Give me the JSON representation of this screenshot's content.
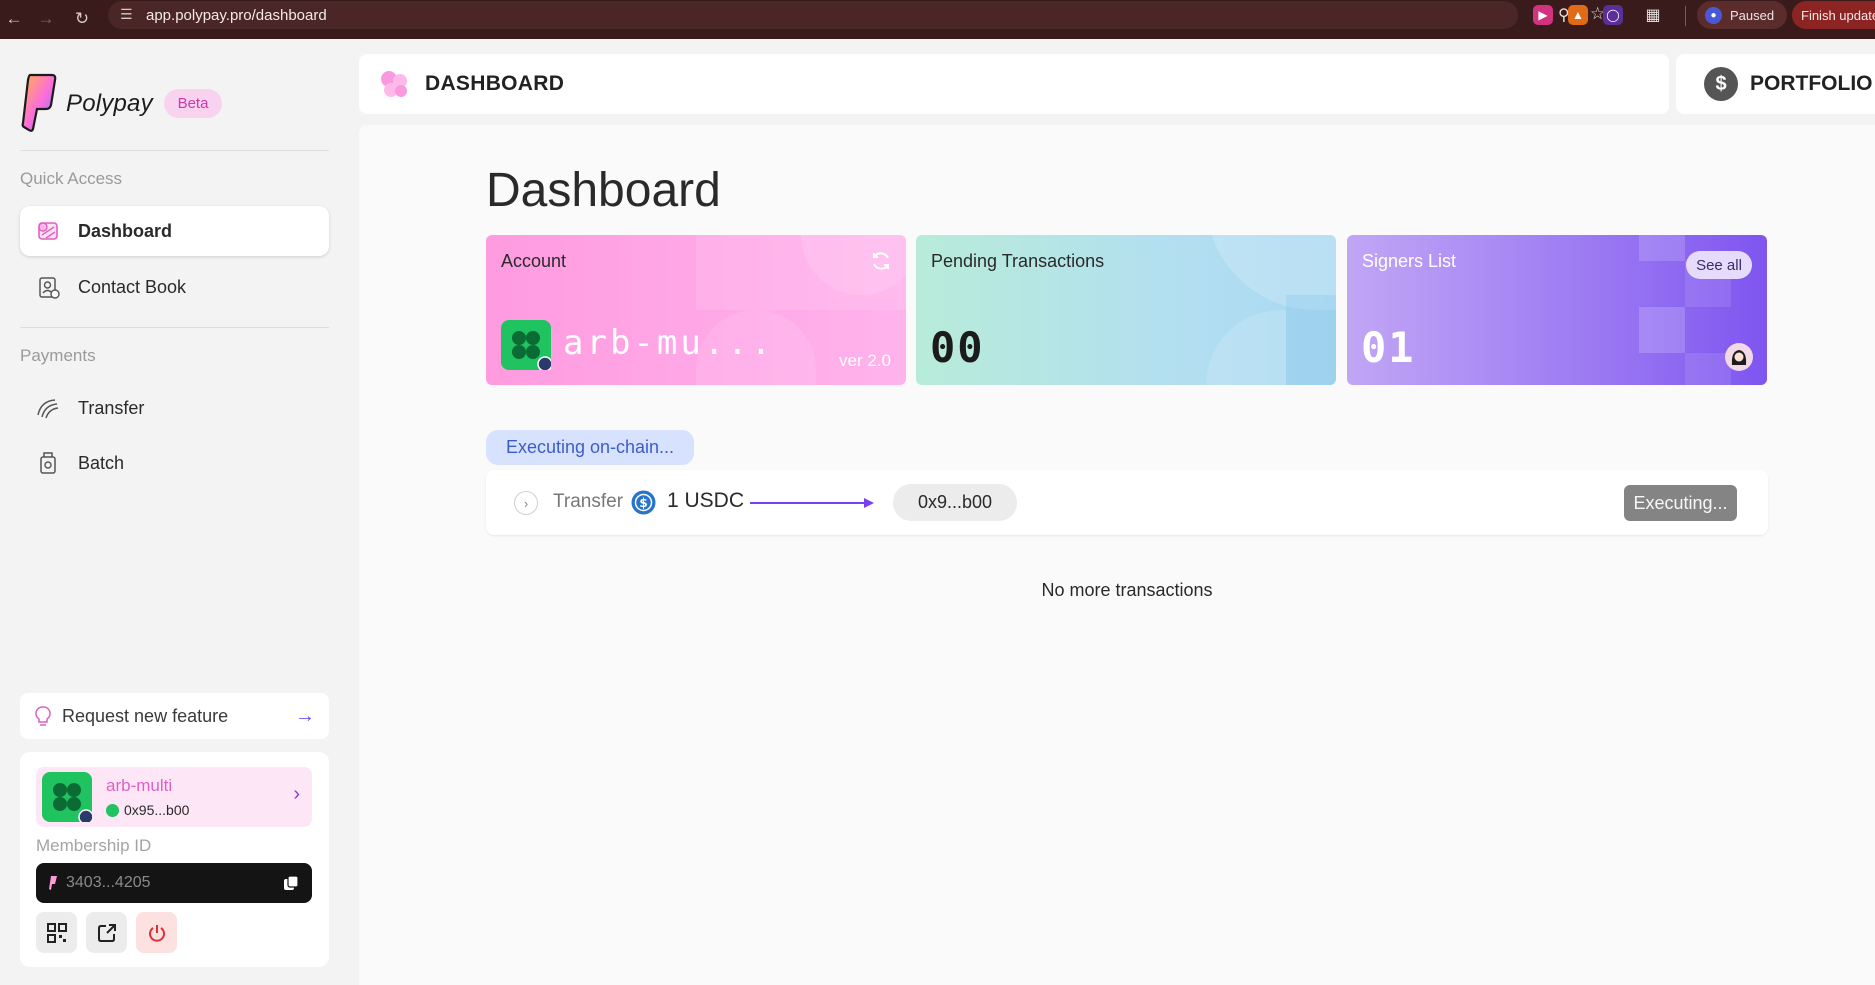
{
  "browser": {
    "url": "app.polypay.pro/dashboard",
    "profile_status": "Paused",
    "update_label": "Finish update"
  },
  "sidebar": {
    "brand": "Polypay",
    "badge": "Beta",
    "quick_access_label": "Quick Access",
    "quick_access": [
      {
        "label": "Dashboard",
        "icon": "dashboard-icon",
        "active": true
      },
      {
        "label": "Contact Book",
        "icon": "contact-book-icon",
        "active": false
      }
    ],
    "payments_label": "Payments",
    "payments": [
      {
        "label": "Transfer",
        "icon": "transfer-icon"
      },
      {
        "label": "Batch",
        "icon": "batch-icon"
      }
    ],
    "feature_request": "Request new feature",
    "account": {
      "name": "arb-multi",
      "address": "0x95...b00",
      "membership_label": "Membership ID",
      "membership_id": "3403...4205"
    }
  },
  "header": {
    "title": "DASHBOARD",
    "portfolio": "PORTFOLIO",
    "portfolio_icon": "$"
  },
  "main": {
    "title": "Dashboard",
    "cards": {
      "account": {
        "title": "Account",
        "name": "arb-mu...",
        "version": "ver 2.0"
      },
      "pending": {
        "title": "Pending Transactions",
        "count": "00"
      },
      "signers": {
        "title": "Signers List",
        "count": "01",
        "see_all": "See all"
      }
    },
    "status_chip": "Executing on-chain...",
    "transaction": {
      "type": "Transfer",
      "amount": "1 USDC",
      "destination": "0x9...b00",
      "status": "Executing..."
    },
    "footer_note": "No more transactions"
  },
  "colors": {
    "accent_pink": "#e060c2",
    "accent_purple": "#6a4ef0",
    "status_blue": "#3d5ccc",
    "account_green": "#1fc35f"
  }
}
